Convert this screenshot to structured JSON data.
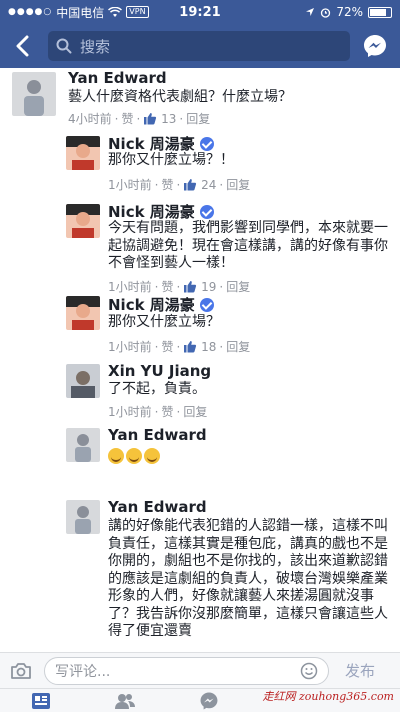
{
  "status_bar": {
    "carrier": "中国电信",
    "vpn": "VPN",
    "time": "19:21",
    "battery": "72%",
    "battery_level": 0.72
  },
  "header": {
    "search_placeholder": "搜索"
  },
  "comments": [
    {
      "name": "Yan Edward",
      "verified": false,
      "text": "藝人什麼資格代表劇組？什麼立場？",
      "time": "4小时前",
      "like_label": "赞",
      "likes": "13",
      "reply_label": "回复"
    },
    {
      "name": "Nick 周湯豪",
      "verified": true,
      "text": "那你又什麼立場？！",
      "time": "1小时前",
      "like_label": "赞",
      "likes": "24",
      "reply_label": "回复"
    },
    {
      "name": "Nick 周湯豪",
      "verified": true,
      "text": "今天有問題，我們影響到同學們，本來就要一起協調避免！現在會這樣講，講的好像有事你不會怪到藝人一樣！",
      "time": "1小时前",
      "like_label": "赞",
      "likes": "19",
      "reply_label": "回复"
    },
    {
      "name": "Nick 周湯豪",
      "verified": true,
      "text": "那你又什麼立場？",
      "time": "1小时前",
      "like_label": "赞",
      "likes": "18",
      "reply_label": "回复"
    },
    {
      "name": "Xin YU Jiang",
      "verified": false,
      "text": "了不起，負責。",
      "time": "1小时前",
      "like_label": "赞",
      "likes": "",
      "reply_label": "回复"
    },
    {
      "name": "Yan Edward",
      "verified": false,
      "text": "",
      "emoji_count": 3,
      "time": "",
      "like_label": "",
      "likes": "",
      "reply_label": ""
    },
    {
      "name": "Yan Edward",
      "verified": false,
      "text": "講的好像能代表犯錯的人認錯一樣，這樣不叫負責任，這樣其實是種包庇，講真的戲也不是你開的，劇組也不是你找的，該出來道歉認錯的應該是這劇組的負責人，破壞台灣娛樂產業形象的人們，好像就讓藝人來搓湯圓就沒事了？我告訴你沒那麼簡單，這樣只會讓這些人得了便宜還賣",
      "time": "",
      "like_label": "",
      "likes": "",
      "reply_label": ""
    }
  ],
  "composer": {
    "placeholder": "写评论...",
    "send_label": "发布"
  },
  "watermark": "走红网 zouhong365.com",
  "colors": {
    "brand": "#3b5998",
    "like_blue": "#4267b2",
    "meta_gray": "#90949c"
  }
}
